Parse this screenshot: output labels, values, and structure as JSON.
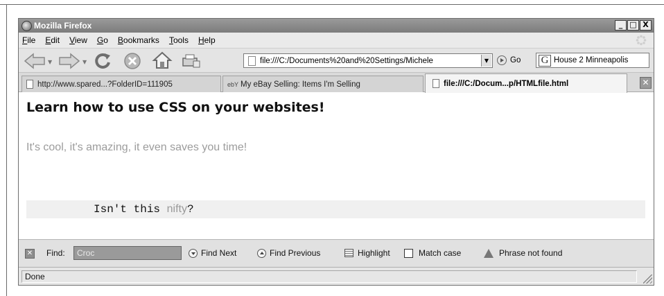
{
  "window": {
    "title": "Mozilla Firefox",
    "controls": [
      "_",
      "□",
      "X"
    ]
  },
  "menubar": {
    "items": [
      {
        "underline": "F",
        "rest": "ile"
      },
      {
        "underline": "E",
        "rest": "dit"
      },
      {
        "underline": "V",
        "rest": "iew"
      },
      {
        "underline": "G",
        "rest": "o"
      },
      {
        "underline": "B",
        "rest": "ookmarks"
      },
      {
        "underline": "T",
        "rest": "ools"
      },
      {
        "underline": "H",
        "rest": "elp"
      }
    ]
  },
  "navbar": {
    "url": "file:///C:/Documents%20and%20Settings/Michele",
    "go_label": "Go",
    "search_engine": "G",
    "search_value": "House 2 Minneapolis"
  },
  "tabs": [
    {
      "label": "http://www.spared...?FolderID=111905",
      "icon": "page-icon",
      "active": false
    },
    {
      "label": "My eBay Selling: Items I'm Selling",
      "prefix": "ebY",
      "icon": "ebay-icon",
      "active": false
    },
    {
      "label": "file:///C:/Docum...p/HTMLfile.html",
      "icon": "page-icon",
      "active": true
    }
  ],
  "tab_close": "✕",
  "content": {
    "heading": "Learn how to use CSS on your websites!",
    "subtext": "It's cool, it's amazing, it even saves you time!",
    "code_before": "Isn't this ",
    "code_nifty": "nifty",
    "code_after": "?"
  },
  "findbar": {
    "close": "✕",
    "label": "Find:",
    "value": "Croc",
    "find_next": "Find Next",
    "find_previous": "Find Previous",
    "highlight": "Highlight",
    "match_case": "Match case",
    "match_case_checked": false,
    "status": "Phrase not found"
  },
  "statusbar": {
    "text": "Done"
  },
  "colors": {
    "content_bg": "#ffffff",
    "chrome": "#e4e4e4",
    "muted_text": "#9c9c9c",
    "code_bg": "#f0f0f0"
  }
}
